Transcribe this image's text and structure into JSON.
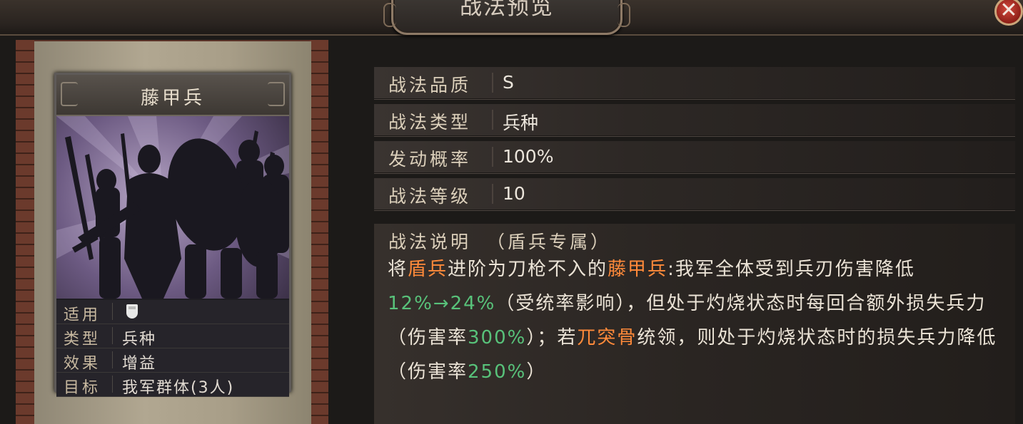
{
  "window": {
    "title": "战法预览",
    "close_label": "✕"
  },
  "card": {
    "name": "藤甲兵",
    "info": [
      {
        "label": "适用",
        "value": "",
        "icon": "shield-icon"
      },
      {
        "label": "类型",
        "value": "兵种"
      },
      {
        "label": "效果",
        "value": "增益"
      },
      {
        "label": "目标",
        "value": "我军群体(3人)"
      }
    ]
  },
  "attributes": [
    {
      "label": "战法品质",
      "value": "S"
    },
    {
      "label": "战法类型",
      "value": "兵种"
    },
    {
      "label": "发动概率",
      "value": "100%"
    },
    {
      "label": "战法等级",
      "value": "10"
    }
  ],
  "description": {
    "label": "战法说明",
    "note": "（盾兵专属）",
    "segments": [
      {
        "text": "将"
      },
      {
        "text": "盾兵",
        "color": "orange"
      },
      {
        "text": "进阶为刀枪不入的"
      },
      {
        "text": "藤甲兵",
        "color": "orange"
      },
      {
        "text": ":我军全体受到兵刃伤害降低"
      },
      {
        "text": "12%→24%",
        "color": "green"
      },
      {
        "text": "（受统率影响），但处于灼烧状态时每回合额外损失兵力（伤害率"
      },
      {
        "text": "300%",
        "color": "green"
      },
      {
        "text": "）；若"
      },
      {
        "text": "兀突骨",
        "color": "orange"
      },
      {
        "text": "统领，则处于灼烧状态时的损失兵力降低（伤害率"
      },
      {
        "text": "250%",
        "color": "green"
      },
      {
        "text": "）"
      }
    ]
  },
  "colors": {
    "highlight_orange": "#ff8a3a",
    "highlight_green": "#58c27a",
    "text_light": "#ebe3d6",
    "label_tan": "#dcd0bb"
  }
}
